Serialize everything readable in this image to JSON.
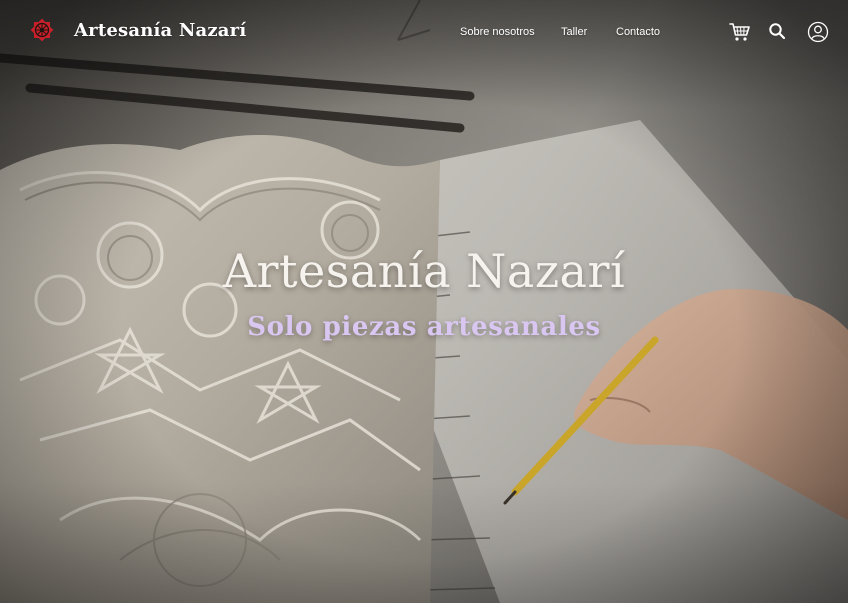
{
  "brand": {
    "name": "Artesanía Nazarí",
    "logo_icon": "eight-point-star-logo-icon",
    "logo_color": "#c8202a"
  },
  "nav": {
    "items": [
      {
        "label": "Sobre nosotros"
      },
      {
        "label": "Taller"
      },
      {
        "label": "Contacto"
      }
    ]
  },
  "header_icons": {
    "cart": "shopping-cart-icon",
    "search": "search-icon",
    "account": "user-account-icon"
  },
  "hero": {
    "title": "Artesanía Nazarí",
    "subtitle": "Solo piezas artesanales",
    "subtitle_color": "#d9c7f2",
    "background": "photo of a hand drawing with a pencil next to a carved plaster Nasrid panel"
  }
}
